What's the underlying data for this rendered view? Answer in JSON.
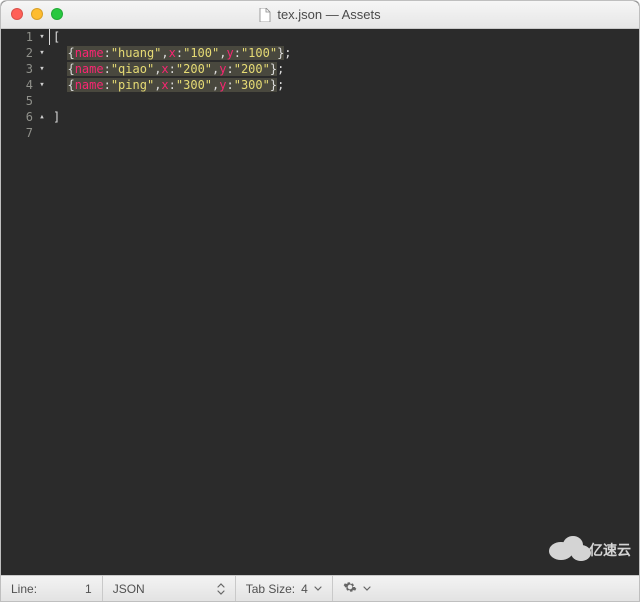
{
  "window": {
    "title": "tex.json — Assets",
    "filename": "tex.json"
  },
  "code": {
    "lines": [
      {
        "num": "1",
        "fold": "fold",
        "content_open": "["
      },
      {
        "num": "2",
        "fold": "fold",
        "obj": {
          "k1": "name",
          "v1": "\"huang\"",
          "k2": "x",
          "v2": "\"100\"",
          "k3": "y",
          "v3": "\"100\""
        }
      },
      {
        "num": "3",
        "fold": "fold",
        "obj": {
          "k1": "name",
          "v1": "\"qiao\"",
          "k2": "x",
          "v2": "\"200\"",
          "k3": "y",
          "v3": "\"200\""
        }
      },
      {
        "num": "4",
        "fold": "fold",
        "obj": {
          "k1": "name",
          "v1": "\"ping\"",
          "k2": "x",
          "v2": "\"300\"",
          "k3": "y",
          "v3": "\"300\""
        }
      },
      {
        "num": "5",
        "fold": "",
        "content_plain": ""
      },
      {
        "num": "6",
        "fold": "up",
        "content_close": "]"
      },
      {
        "num": "7",
        "fold": "",
        "content_plain": ""
      }
    ]
  },
  "status": {
    "line_label": "Line:",
    "line_value": "1",
    "syntax": "JSON",
    "tabsize_label": "Tab Size:",
    "tabsize_value": "4"
  },
  "watermark": {
    "text": "亿速云"
  }
}
